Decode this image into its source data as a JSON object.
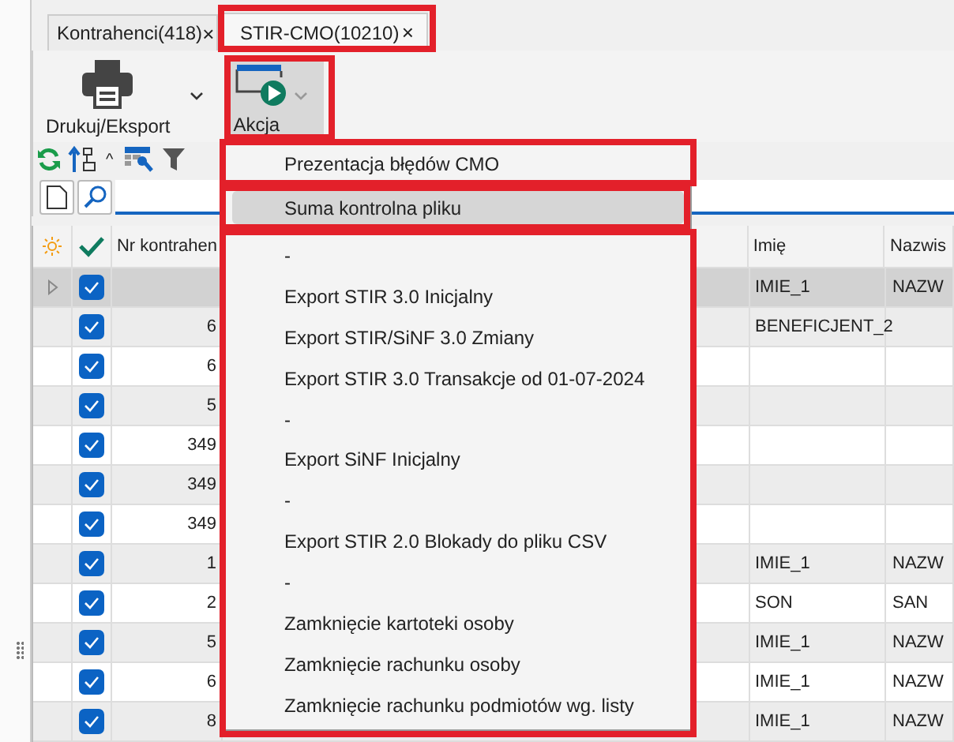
{
  "tabs": [
    {
      "label": "Kontrahenci(418)",
      "close": "×",
      "selected": false
    },
    {
      "label": "STIR-CMO(10210)",
      "close": "×",
      "selected": true
    }
  ],
  "toolbar": {
    "buttons": [
      {
        "label": "Drukuj/Eksport",
        "kind": "print",
        "selected": false
      },
      {
        "label": "Akcja",
        "kind": "action",
        "selected": true
      }
    ],
    "sort_caret": "^"
  },
  "grid": {
    "columns": [
      {
        "label": "Nr kontrahen"
      },
      {
        "label": "Imię"
      },
      {
        "label": "Nazwis"
      }
    ],
    "rows": [
      {
        "selected": true,
        "checked": true,
        "cells": [
          "",
          "IMIE_1",
          "NAZW"
        ]
      },
      {
        "selected": false,
        "checked": true,
        "cells": [
          "6",
          "BENEFICJENT_2",
          ""
        ]
      },
      {
        "selected": false,
        "checked": true,
        "cells": [
          "6",
          "",
          ""
        ]
      },
      {
        "selected": false,
        "checked": true,
        "cells": [
          "5",
          "",
          ""
        ]
      },
      {
        "selected": false,
        "checked": true,
        "cells": [
          "349",
          "",
          ""
        ]
      },
      {
        "selected": false,
        "checked": true,
        "cells": [
          "349",
          "",
          ""
        ]
      },
      {
        "selected": false,
        "checked": true,
        "cells": [
          "349",
          "",
          ""
        ]
      },
      {
        "selected": false,
        "checked": true,
        "cells": [
          "1",
          "IMIE_1",
          "NAZW"
        ]
      },
      {
        "selected": false,
        "checked": true,
        "cells": [
          "2",
          "SON",
          "SAN"
        ]
      },
      {
        "selected": false,
        "checked": true,
        "cells": [
          "5",
          "IMIE_1",
          "NAZW"
        ]
      },
      {
        "selected": false,
        "checked": true,
        "cells": [
          "6",
          "IMIE_1",
          "NAZW"
        ]
      },
      {
        "selected": false,
        "checked": true,
        "cells": [
          "8",
          "IMIE_1",
          "NAZW"
        ]
      }
    ]
  },
  "menu": {
    "items": [
      {
        "label": "Prezentacja błędów CMO",
        "selected": false
      },
      {
        "label": "Suma kontrolna pliku",
        "selected": true
      },
      {
        "label": "-",
        "selected": false
      },
      {
        "label": "Export STIR 3.0 Inicjalny",
        "selected": false
      },
      {
        "label": "Export STIR/SiNF 3.0 Zmiany",
        "selected": false
      },
      {
        "label": "Export STIR 3.0 Transakcje od 01-07-2024",
        "selected": false
      },
      {
        "label": "-",
        "selected": false
      },
      {
        "label": "Export SiNF Inicjalny",
        "selected": false
      },
      {
        "label": "-",
        "selected": false
      },
      {
        "label": "Export STIR 2.0 Blokady do pliku CSV",
        "selected": false
      },
      {
        "label": "-",
        "selected": false
      },
      {
        "label": "Zamknięcie kartoteki osoby",
        "selected": false
      },
      {
        "label": "Zamknięcie rachunku osoby",
        "selected": false
      },
      {
        "label": "Zamknięcie rachunku podmiotów wg. listy",
        "selected": false
      }
    ]
  }
}
